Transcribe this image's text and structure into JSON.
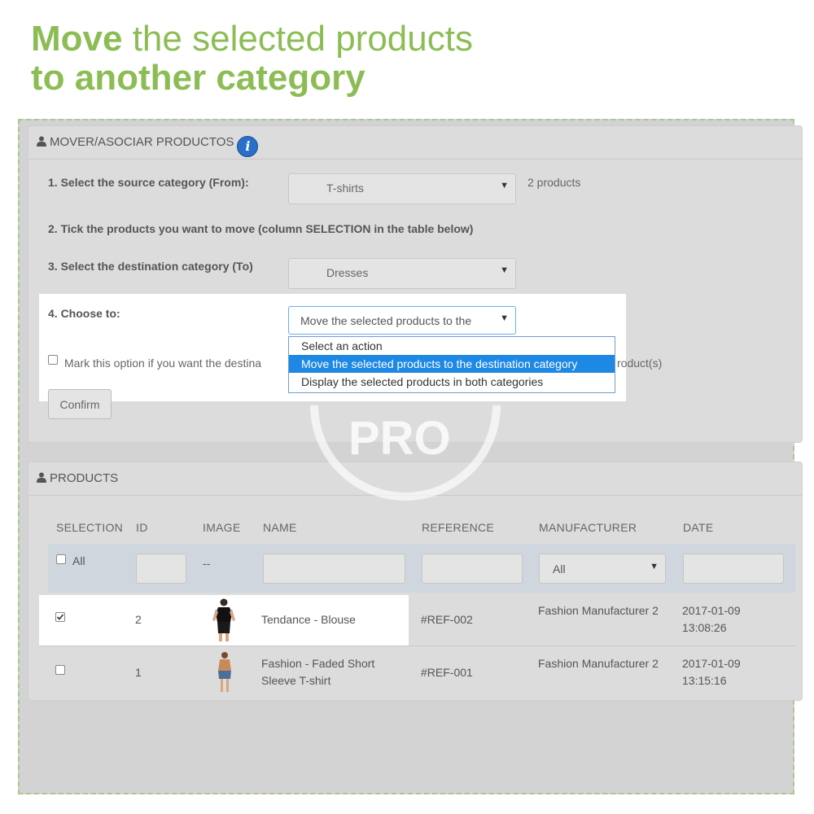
{
  "headline": {
    "bold1": "Move",
    "rest1": " the selected products",
    "line2": "to another category"
  },
  "mover": {
    "title": "MOVER/ASOCIAR PRODUCTOS",
    "step1_label": "1. Select the source category (From):",
    "step1_value": "T-shirts",
    "step1_count": "2 products",
    "step2_label": "2. Tick the products you want to move (column SELECTION in the table below)",
    "step3_label": "3. Select the destination category (To)",
    "step3_value": "Dresses",
    "step4_label": "4. Choose to:",
    "step4_value": "Move the selected products to the",
    "options": [
      "Select an action",
      "Move the selected products to the destination category",
      "Display the selected products in both categories"
    ],
    "mark_label_a": "Mark this option if you want the destina",
    "mark_label_b": "roduct(s)",
    "confirm": "Confirm"
  },
  "products": {
    "title": "PRODUCTS",
    "columns": [
      "SELECTION",
      "ID",
      "IMAGE",
      "NAME",
      "REFERENCE",
      "MANUFACTURER",
      "DATE"
    ],
    "filter_all": "All",
    "filter_image": "--",
    "filter_manufacturer": "All",
    "rows": [
      {
        "id": "2",
        "name": "Tendance - Blouse",
        "reference": "#REF-002",
        "manufacturer": "Fashion Manufacturer 2",
        "date": "2017-01-09 13:08:26",
        "checked": true
      },
      {
        "id": "1",
        "name": "Fashion - Faded Short Sleeve T-shirt",
        "reference": "#REF-001",
        "manufacturer": "Fashion Manufacturer 2",
        "date": "2017-01-09 13:15:16",
        "checked": false
      }
    ]
  },
  "watermark": "PRO",
  "colors": {
    "accent": "#8cbd55",
    "highlight": "#1e88e5"
  }
}
